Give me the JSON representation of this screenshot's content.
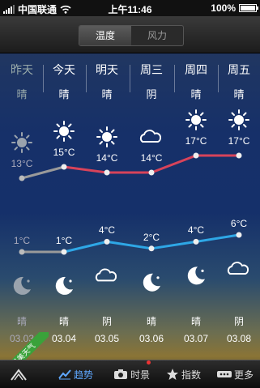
{
  "status": {
    "carrier": "中国联通",
    "time": "上午11:46",
    "battery": "100%"
  },
  "toggle": {
    "active": "温度",
    "inactive": "风力"
  },
  "days": [
    {
      "name": "昨天",
      "weather": "晴",
      "high": "13°C",
      "low": "1°C",
      "date": "03.03",
      "bottom_weather": "晴",
      "day_icon": "sun-icon",
      "night_icon": "moon-icon",
      "dim": true
    },
    {
      "name": "今天",
      "weather": "晴",
      "high": "15°C",
      "low": "1°C",
      "date": "03.04",
      "bottom_weather": "晴",
      "day_icon": "sun-icon",
      "night_icon": "moon-icon",
      "dim": false
    },
    {
      "name": "明天",
      "weather": "晴",
      "high": "14°C",
      "low": "4°C",
      "date": "03.05",
      "bottom_weather": "阴",
      "day_icon": "sun-icon",
      "night_icon": "cloud-icon",
      "dim": false
    },
    {
      "name": "周三",
      "weather": "阴",
      "high": "14°C",
      "low": "2°C",
      "date": "03.06",
      "bottom_weather": "晴",
      "day_icon": "cloud-icon",
      "night_icon": "moon-icon",
      "dim": false
    },
    {
      "name": "周四",
      "weather": "晴",
      "high": "17°C",
      "low": "4°C",
      "date": "03.07",
      "bottom_weather": "晴",
      "day_icon": "sun-icon",
      "night_icon": "moon-icon",
      "dim": false
    },
    {
      "name": "周五",
      "weather": "晴",
      "high": "17°C",
      "low": "6°C",
      "date": "03.08",
      "bottom_weather": "阴",
      "day_icon": "sun-icon",
      "night_icon": "cloud-icon",
      "dim": false
    }
  ],
  "chart_data": {
    "type": "line",
    "categories": [
      "昨天",
      "今天",
      "明天",
      "周三",
      "周四",
      "周五"
    ],
    "series": [
      {
        "values": [
          13,
          15,
          14,
          14,
          17,
          17
        ]
      },
      {
        "values": [
          1,
          1,
          4,
          2,
          4,
          6
        ]
      }
    ],
    "colors": {
      "high": "#d8435a",
      "low": "#2ea7e6",
      "past": "#9a9a9a"
    }
  },
  "tabs": [
    {
      "label": "",
      "icon": "share-icon"
    },
    {
      "label": "趋势",
      "icon": "trend-icon"
    },
    {
      "label": "时景",
      "icon": "camera-icon"
    },
    {
      "label": "指数",
      "icon": "star-icon"
    },
    {
      "label": "更多",
      "icon": "more-icon"
    }
  ],
  "ribbon": "最美天气"
}
